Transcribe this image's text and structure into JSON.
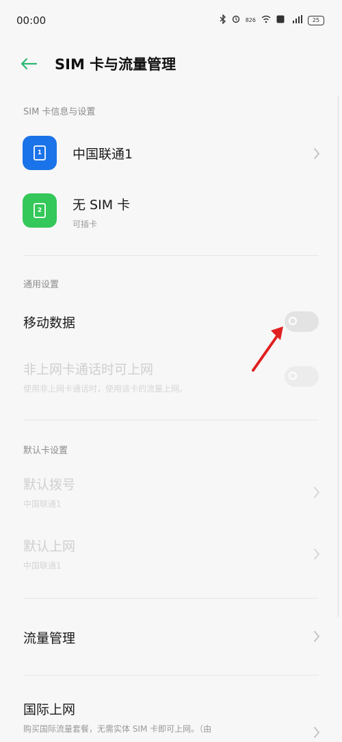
{
  "status_bar": {
    "time": "00:00",
    "icons": [
      "bluetooth-icon",
      "alarm-icon",
      "net-speed-icon",
      "wifi-icon",
      "hd-icon",
      "signal-icon",
      "battery-icon"
    ],
    "net_speed": "826",
    "battery_level": "25"
  },
  "header": {
    "title": "SIM 卡与流量管理"
  },
  "sim_section": {
    "label": "SIM 卡信息与设置",
    "cards": [
      {
        "name": "中国联通1",
        "slot": "1",
        "color": "#1a73e8"
      },
      {
        "name": "无 SIM 卡",
        "sub": "可插卡",
        "slot": "2",
        "color": "#34c759"
      }
    ]
  },
  "general_section": {
    "label": "通用设置",
    "mobile_data": {
      "label": "移动数据",
      "enabled": false
    },
    "non_data_call": {
      "label": "非上网卡通话时可上网",
      "sub": "使用非上网卡通话时，使用该卡的流量上网。",
      "enabled": false
    }
  },
  "default_section": {
    "label": "默认卡设置",
    "default_call": {
      "label": "默认拨号",
      "value": "中国联通1"
    },
    "default_data": {
      "label": "默认上网",
      "value": "中国联通1"
    }
  },
  "traffic": {
    "label": "流量管理"
  },
  "international": {
    "label": "国际上网",
    "sub": "购买国际流量套餐，无需实体 SIM 卡即可上网。（由"
  },
  "colors": {
    "accent": "#2bb673",
    "annotation": "#e02020"
  }
}
